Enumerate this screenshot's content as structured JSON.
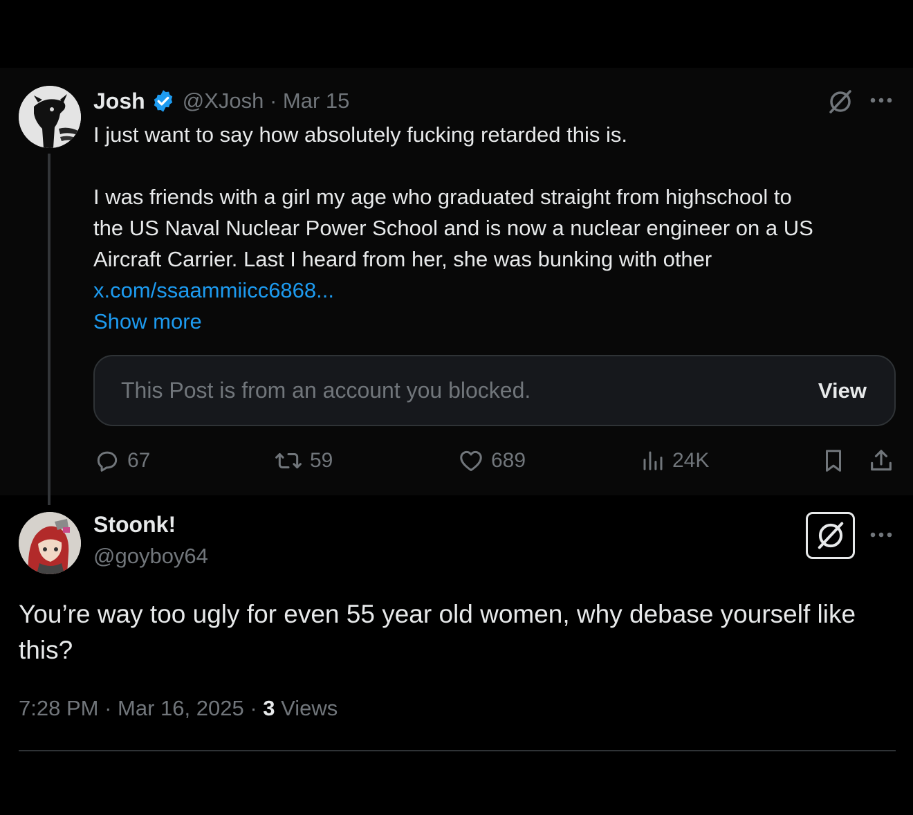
{
  "parent": {
    "author_name": "Josh",
    "handle": "@XJosh",
    "separator": "·",
    "date": "Mar 15",
    "text_lines": [
      "I just want to say how absolutely fucking retarded this is.",
      "I was friends with a girl my age who graduated straight from highschool to",
      "the US Naval Nuclear Power School and is now a nuclear engineer on a US",
      "Aircraft Carrier. Last I heard from her, she was bunking with other"
    ],
    "link": "x.com/ssaammiicc6868...",
    "show_more": "Show more",
    "quoted": {
      "text": "This Post is from an account you blocked.",
      "view_label": "View"
    },
    "stats": {
      "replies": "67",
      "reposts": "59",
      "likes": "689",
      "views": "24K"
    }
  },
  "reply": {
    "author_name": "Stoonk!",
    "handle": "@goyboy64",
    "text": "You’re way too ugly for even 55 year old women, why debase yourself like this?",
    "time": "7:28 PM",
    "separator": "·",
    "date": "Mar 16, 2025",
    "views_count": "3",
    "views_label": "Views"
  },
  "icons": {
    "verified": "verified-badge-icon",
    "grok": "grok-icon",
    "more": "more-options-icon",
    "reply": "reply-icon",
    "repost": "repost-icon",
    "like": "heart-icon",
    "views": "views-icon",
    "bookmark": "bookmark-icon",
    "share": "share-icon"
  },
  "colors": {
    "background": "#000000",
    "text": "#e7e9ea",
    "muted": "#71767b",
    "link": "#1d9bf0",
    "verified": "#1d9bf0"
  }
}
